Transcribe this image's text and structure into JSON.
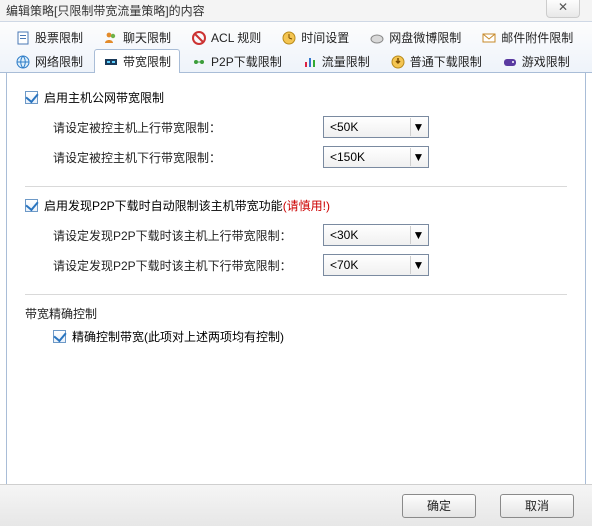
{
  "window": {
    "title": "编辑策略[只限制带宽流量策略]的内容",
    "close_glyph": "✕"
  },
  "tabs_row1": [
    {
      "label": "股票限制"
    },
    {
      "label": "聊天限制"
    },
    {
      "label": "ACL 规则"
    },
    {
      "label": "时间设置"
    },
    {
      "label": "网盘微博限制"
    },
    {
      "label": "邮件附件限制"
    }
  ],
  "tabs_row2": [
    {
      "label": "网络限制"
    },
    {
      "label": "带宽限制"
    },
    {
      "label": "P2P下载限制"
    },
    {
      "label": "流量限制"
    },
    {
      "label": "普通下载限制"
    },
    {
      "label": "游戏限制"
    }
  ],
  "panel": {
    "hostbw": {
      "enable_label": "启用主机公网带宽限制",
      "up_label": "请设定被控主机上行带宽限制：",
      "down_label": "请设定被控主机下行带宽限制：",
      "up_value": "<50K",
      "down_value": "<150K"
    },
    "p2p": {
      "enable_label": "启用发现P2P下载时自动限制该主机带宽功能",
      "enable_warn": "(请慎用!)",
      "up_label": "请设定发现P2P下载时该主机上行带宽限制：",
      "down_label": "请设定发现P2P下载时该主机下行带宽限制：",
      "up_value": "<30K",
      "down_value": "<70K"
    },
    "precise": {
      "group_title": "带宽精确控制",
      "enable_label": "精确控制带宽(此项对上述两项均有控制)"
    }
  },
  "footer": {
    "ok": "确定",
    "cancel": "取消"
  }
}
